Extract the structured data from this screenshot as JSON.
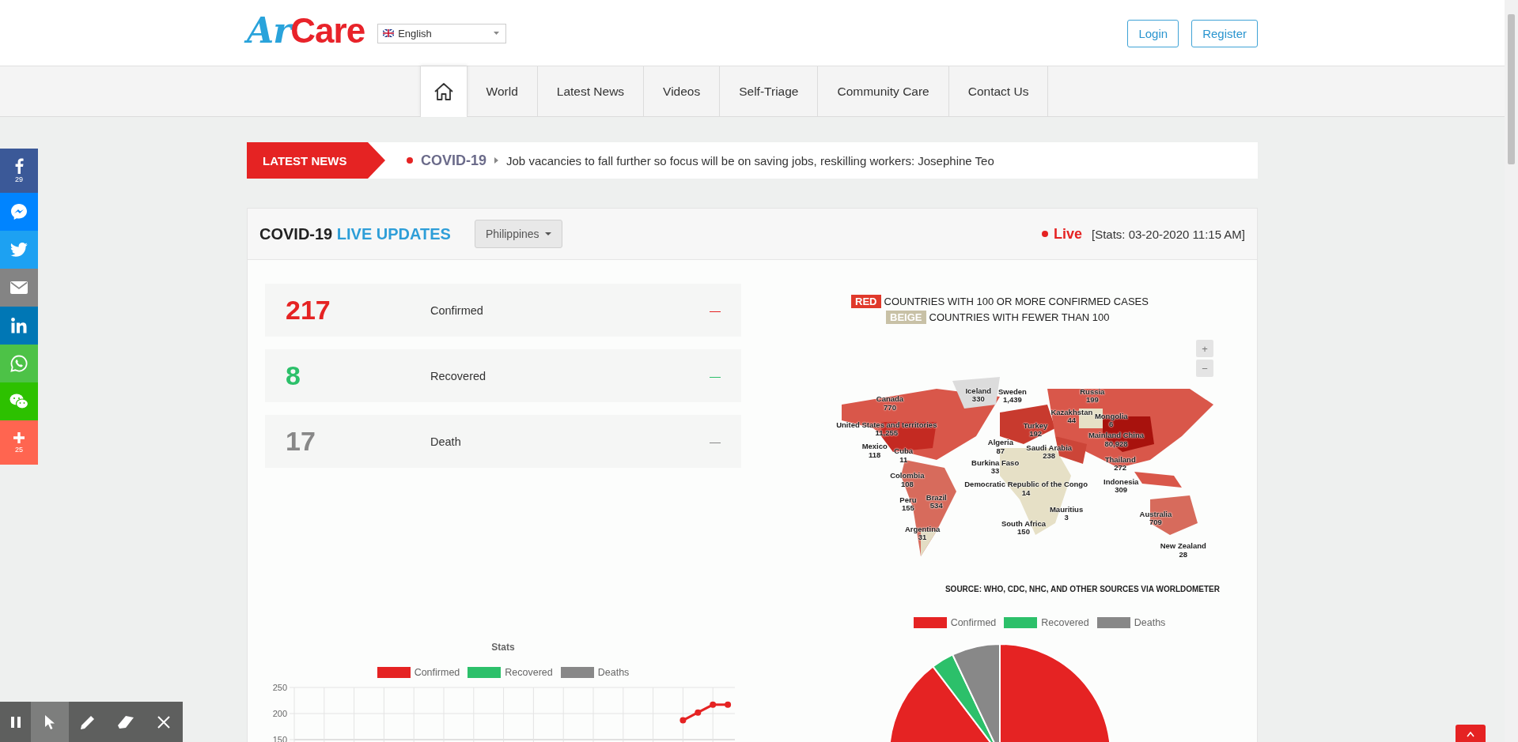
{
  "header": {
    "logo": {
      "first": "Ar",
      "second": "Care"
    },
    "language": {
      "value": "English"
    },
    "buttons": [
      "Login",
      "Register"
    ]
  },
  "nav": {
    "items": [
      {
        "kind": "home",
        "selected": true
      },
      {
        "kind": "text",
        "label": "World",
        "selected": false
      },
      {
        "kind": "text",
        "label": "Latest News",
        "selected": false
      },
      {
        "kind": "text",
        "label": "Videos",
        "selected": false
      },
      {
        "kind": "text",
        "label": "Self-Triage",
        "selected": false
      },
      {
        "kind": "text",
        "label": "Community Care",
        "selected": false
      },
      {
        "kind": "text",
        "label": "Contact Us",
        "selected": false
      }
    ]
  },
  "ticker": {
    "badge": "LATEST NEWS",
    "tag": "COVID-19",
    "headline": "Job vacancies to fall further so focus will be on saving jobs, reskilling workers: Josephine Teo"
  },
  "social": [
    {
      "kind": "facebook",
      "count": "29"
    },
    {
      "kind": "messenger"
    },
    {
      "kind": "twitter"
    },
    {
      "kind": "email"
    },
    {
      "kind": "linkedin"
    },
    {
      "kind": "whatsapp"
    },
    {
      "kind": "wechat"
    },
    {
      "kind": "share",
      "count": "25"
    }
  ],
  "panel": {
    "title": "COVID-19",
    "title_highlight": "LIVE UPDATES",
    "country": "Philippines",
    "live": "Live",
    "stats_time": "[Stats: 03-20-2020 11:15 AM]"
  },
  "counters": [
    {
      "value": "217",
      "label": "Confirmed",
      "trend": "—",
      "color": "#e52323"
    },
    {
      "value": "8",
      "label": "Recovered",
      "trend": "—",
      "color": "#2cc06a"
    },
    {
      "value": "17",
      "label": "Death",
      "trend": "—",
      "color": "#888888"
    }
  ],
  "map": {
    "legend": [
      {
        "tag": "RED",
        "text": "COUNTRIES WITH 100 OR MORE CONFIRMED CASES",
        "color": "#e0392b"
      },
      {
        "tag": "BEIGE",
        "text": "COUNTRIES WITH FEWER THAN 100",
        "color": "#c8c1a6"
      }
    ],
    "zoom": [
      "+",
      "−"
    ],
    "labels": [
      {
        "name": "Iceland",
        "value": "330"
      },
      {
        "name": "Sweden",
        "value": "1,439"
      },
      {
        "name": "Russia",
        "value": "199"
      },
      {
        "name": "Canada",
        "value": "770"
      },
      {
        "name": "Kazakhstan",
        "value": "44"
      },
      {
        "name": "Mongolia",
        "value": "6"
      },
      {
        "name": "Turkey",
        "value": "192"
      },
      {
        "name": "United States and territories",
        "value": "11,255"
      },
      {
        "name": "Mainland China",
        "value": "80,928"
      },
      {
        "name": "Algeria",
        "value": "87"
      },
      {
        "name": "Mexico",
        "value": "118"
      },
      {
        "name": "Cuba",
        "value": "11"
      },
      {
        "name": "Saudi Arabia",
        "value": "238"
      },
      {
        "name": "Burkina Faso",
        "value": "33"
      },
      {
        "name": "Thailand",
        "value": "272"
      },
      {
        "name": "Colombia",
        "value": "108"
      },
      {
        "name": "Democratic Republic of the Congo",
        "value": "14"
      },
      {
        "name": "Indonesia",
        "value": "309"
      },
      {
        "name": "Peru",
        "value": "155"
      },
      {
        "name": "Brazil",
        "value": "534"
      },
      {
        "name": "Mauritius",
        "value": "3"
      },
      {
        "name": "Australia",
        "value": "709"
      },
      {
        "name": "South Africa",
        "value": "150"
      },
      {
        "name": "Argentina",
        "value": "31"
      },
      {
        "name": "New Zealand",
        "value": "28"
      }
    ],
    "source": "SOURCE: WHO, CDC, NHC, AND OTHER SOURCES VIA WORLDOMETER"
  },
  "line_chart": {
    "chart_data": {
      "type": "line",
      "title": "Stats",
      "ylim": [
        150,
        250
      ],
      "yticks": [
        150,
        200,
        250
      ],
      "grid": true,
      "legend": true,
      "series": [
        {
          "name": "Confirmed",
          "color": "#e52323",
          "marker": true,
          "values": [
            null,
            null,
            null,
            null,
            null,
            null,
            null,
            null,
            null,
            null,
            null,
            null,
            null,
            null,
            null,
            null,
            null,
            null,
            null,
            null,
            null,
            null,
            null,
            null,
            null,
            null,
            187,
            202,
            217,
            217
          ]
        },
        {
          "name": "Recovered",
          "color": "#2cc06a",
          "values": [
            null,
            null,
            null,
            null,
            null,
            null,
            null,
            null,
            null,
            null,
            null,
            null,
            null,
            null,
            null,
            null,
            null,
            null,
            null,
            null,
            null,
            null,
            null,
            null,
            null,
            null,
            null,
            null,
            null,
            null
          ]
        },
        {
          "name": "Deaths",
          "color": "#888888",
          "values": [
            null,
            null,
            null,
            null,
            null,
            null,
            null,
            null,
            null,
            null,
            null,
            null,
            null,
            null,
            null,
            null,
            null,
            null,
            null,
            null,
            null,
            null,
            null,
            null,
            null,
            null,
            null,
            null,
            null,
            null
          ]
        }
      ]
    }
  },
  "pie_chart": {
    "chart_data": {
      "type": "pie",
      "legend": true,
      "categories": [
        "Confirmed",
        "Recovered",
        "Deaths"
      ],
      "values": [
        89.67,
        3.31,
        7.02
      ]
    }
  },
  "recorder_toolbar": {
    "tools": [
      {
        "kind": "pause",
        "selected": false
      },
      {
        "kind": "pointer",
        "selected": true
      },
      {
        "kind": "pen",
        "selected": false
      },
      {
        "kind": "eraser",
        "selected": false
      },
      {
        "kind": "close",
        "selected": false
      }
    ]
  }
}
